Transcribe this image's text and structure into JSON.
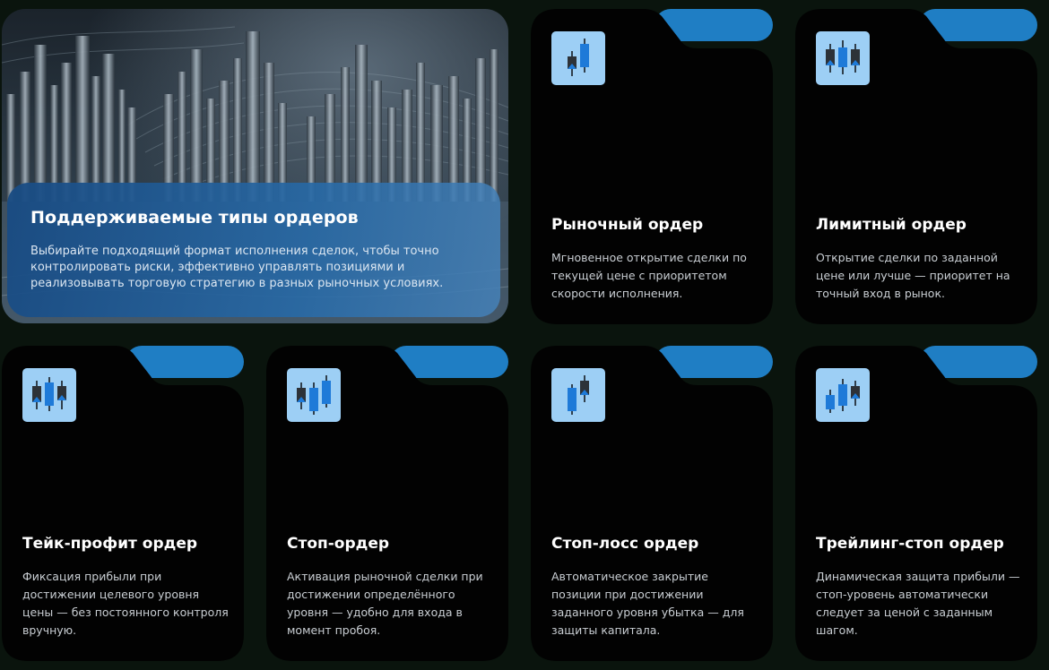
{
  "hero": {
    "title": "Поддерживаемые типы ордеров",
    "description": "Выбирайте подходящий формат исполнения сделок, чтобы точно контролировать риски, эффективно управлять позициями и реализовывать торговую стратегию в разных рыночных условиях."
  },
  "cards": [
    {
      "title": "Рыночный ордер",
      "description": "Мгновенное открытие сделки по текущей цене с приоритетом скорости исполнения.",
      "icon": "candlestick-2-icon"
    },
    {
      "title": "Лимитный ордер",
      "description": "Открытие сделки по заданной цене или лучше — приоритет на точный вход в рынок.",
      "icon": "candlestick-3-icon"
    },
    {
      "title": "Тейк-профит ордер",
      "description": "Фиксация прибыли при достижении целевого уровня цены — без постоянного контроля вручную.",
      "icon": "candlestick-3-icon"
    },
    {
      "title": "Стоп-ордер",
      "description": "Активация рыночной сделки при достижении определённого уровня — удобно для входа в момент пробоя.",
      "icon": "candlestick-3-icon"
    },
    {
      "title": "Стоп-лосс ордер",
      "description": "Автоматическое закрытие позиции при достижении заданного уровня убытка — для защиты капитала.",
      "icon": "candlestick-2-icon"
    },
    {
      "title": "Трейлинг-стоп ордер",
      "description": "Динамическая защита прибыли — стоп-уровень автоматически следует за ценой с заданным шагом.",
      "icon": "candlestick-3-icon"
    }
  ],
  "colors": {
    "accent": "#1f7ec4",
    "icon_bg": "#9dcff5",
    "card_bg": "#020202",
    "page_bg": "#0a140d"
  }
}
